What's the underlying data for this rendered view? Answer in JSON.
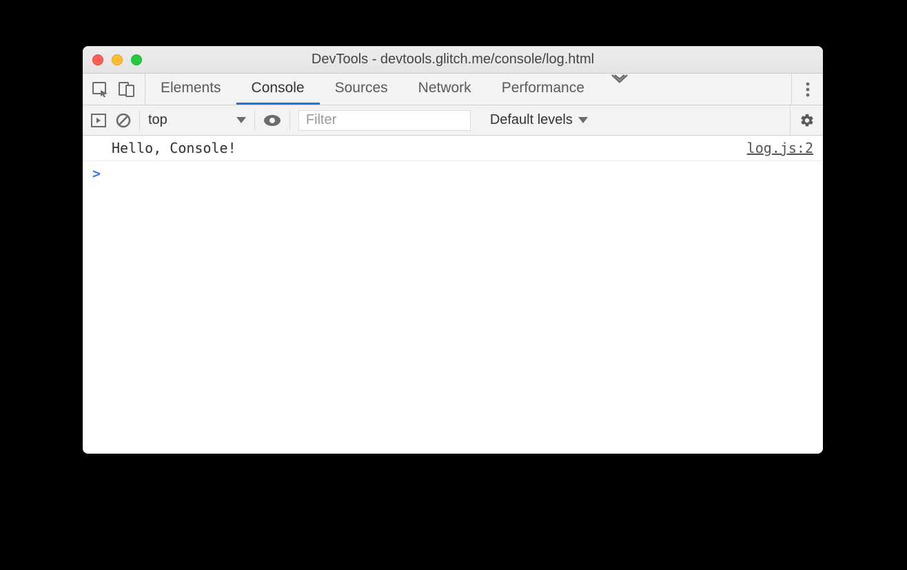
{
  "window": {
    "title": "DevTools - devtools.glitch.me/console/log.html"
  },
  "tabs": {
    "items": [
      "Elements",
      "Console",
      "Sources",
      "Network",
      "Performance"
    ],
    "active": "Console"
  },
  "toolbar": {
    "context": "top",
    "filter_placeholder": "Filter",
    "levels_label": "Default levels"
  },
  "console": {
    "logs": [
      {
        "text": "Hello, Console!",
        "source": "log.js:2"
      }
    ],
    "prompt": ">"
  }
}
